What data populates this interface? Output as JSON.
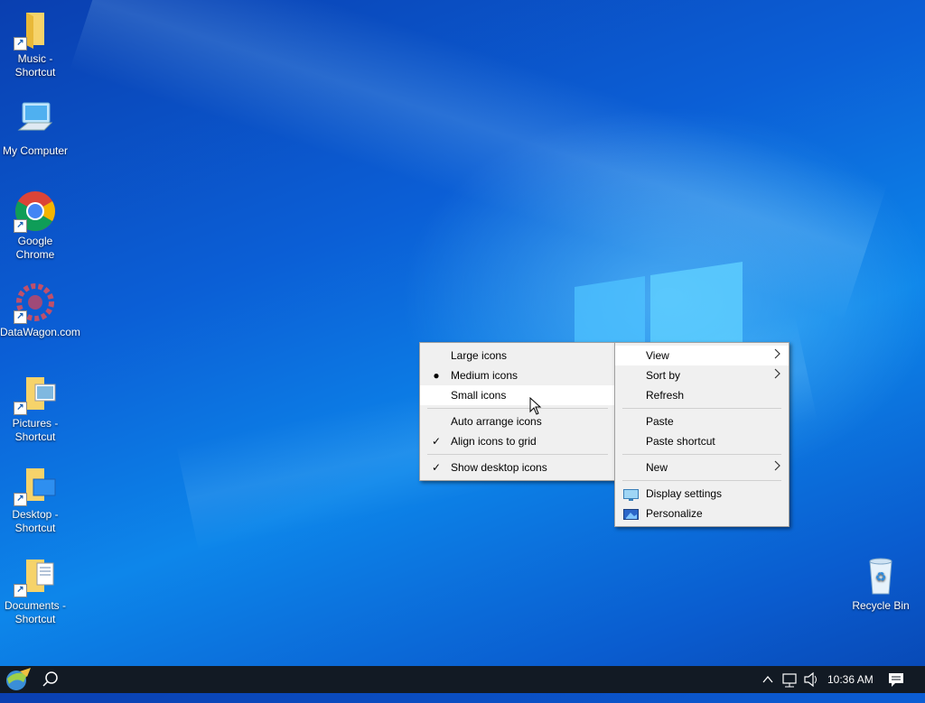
{
  "desktop_icons": [
    {
      "label": "Music - Shortcut",
      "icon": "folder-music-icon"
    },
    {
      "label": "My Computer",
      "icon": "computer-icon"
    },
    {
      "label": "Google Chrome",
      "icon": "chrome-icon"
    },
    {
      "label": "DataWagon.com",
      "icon": "datawagon-icon"
    },
    {
      "label": "Pictures - Shortcut",
      "icon": "folder-pictures-icon"
    },
    {
      "label": "Desktop - Shortcut",
      "icon": "folder-desktop-icon"
    },
    {
      "label": "Documents - Shortcut",
      "icon": "folder-documents-icon"
    },
    {
      "label": "Recycle Bin",
      "icon": "recycle-bin-icon"
    }
  ],
  "view_submenu": {
    "items": [
      {
        "label": "Large icons",
        "mark": ""
      },
      {
        "label": "Medium icons",
        "mark": "●"
      },
      {
        "label": "Small icons",
        "mark": ""
      },
      {
        "label": "Auto arrange icons",
        "mark": ""
      },
      {
        "label": "Align icons to grid",
        "mark": "✓"
      },
      {
        "label": "Show desktop icons",
        "mark": "✓"
      }
    ]
  },
  "context_menu": {
    "items": [
      {
        "label": "View"
      },
      {
        "label": "Sort by"
      },
      {
        "label": "Refresh"
      },
      {
        "label": "Paste"
      },
      {
        "label": "Paste shortcut"
      },
      {
        "label": "New"
      },
      {
        "label": "Display settings"
      },
      {
        "label": "Personalize"
      }
    ]
  },
  "taskbar": {
    "clock": "10:36 AM",
    "icons": [
      "start-icon",
      "search-icon",
      "chevron-up-icon",
      "network-icon",
      "volume-icon",
      "notification-icon"
    ]
  },
  "colors": {
    "accent": "#0b78e3",
    "taskbar": "#121a24",
    "menu_bg": "#f0f0f0"
  }
}
